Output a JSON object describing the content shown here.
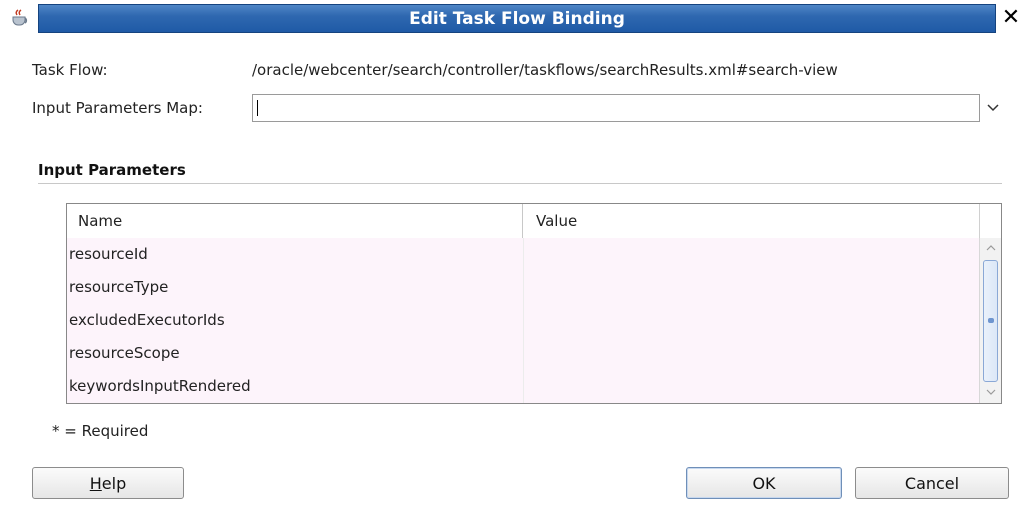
{
  "window": {
    "title": "Edit Task Flow Binding",
    "close_icon": "close-icon",
    "app_icon": "java-cup-icon"
  },
  "form": {
    "task_flow_label": "Task Flow:",
    "task_flow_value": "/oracle/webcenter/search/controller/taskflows/searchResults.xml#search-view",
    "input_map_label": "Input Parameters Map:",
    "input_map_value": ""
  },
  "input_parameters": {
    "section_title": "Input Parameters",
    "columns": [
      "Name",
      "Value"
    ],
    "rows": [
      {
        "name": "resourceId",
        "value": ""
      },
      {
        "name": "resourceType",
        "value": ""
      },
      {
        "name": "excludedExecutorIds",
        "value": ""
      },
      {
        "name": "resourceScope",
        "value": ""
      },
      {
        "name": "keywordsInputRendered",
        "value": ""
      }
    ]
  },
  "required_note": "* = Required",
  "buttons": {
    "help_mnemonic": "H",
    "help_rest": "elp",
    "ok": "OK",
    "cancel": "Cancel"
  },
  "colors": {
    "title_bar": "#2f68b0",
    "row_background": "#fdf4fb"
  }
}
